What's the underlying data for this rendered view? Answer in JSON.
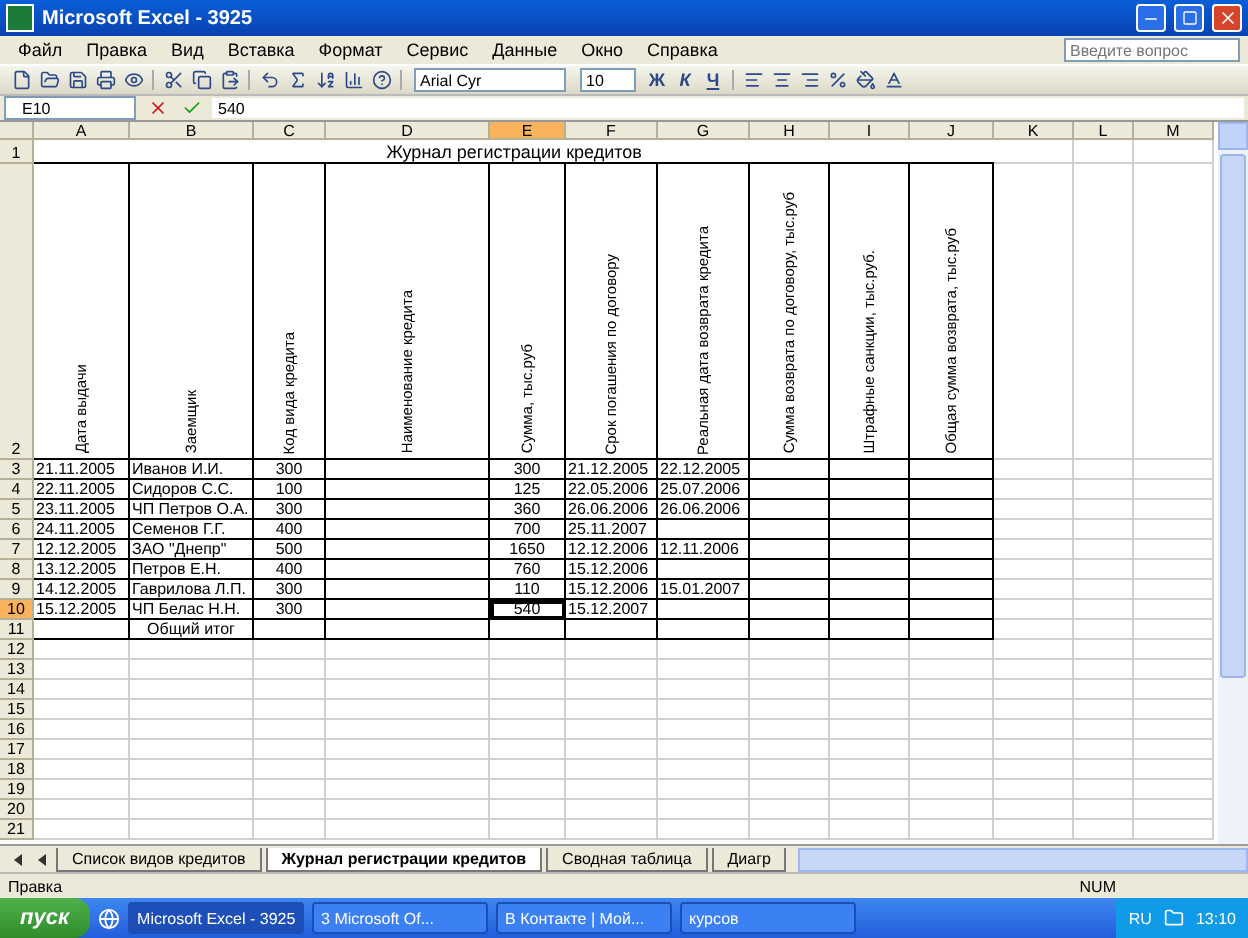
{
  "window": {
    "title": "Microsoft Excel - 3925"
  },
  "menu": [
    "Файл",
    "Правка",
    "Вид",
    "Вставка",
    "Формат",
    "Сервис",
    "Данные",
    "Окно",
    "Справка"
  ],
  "help_box": {
    "placeholder": "Введите вопрос"
  },
  "font": {
    "name": "Arial Cyr",
    "size": "10"
  },
  "format_buttons": [
    "Ж",
    "К",
    "Ч"
  ],
  "formula_bar": {
    "cell": "E10",
    "value": "540"
  },
  "columns": [
    {
      "label": "A",
      "selected": false
    },
    {
      "label": "B",
      "selected": false
    },
    {
      "label": "C",
      "selected": false
    },
    {
      "label": "D",
      "selected": false
    },
    {
      "label": "E",
      "selected": true
    },
    {
      "label": "F",
      "selected": false
    },
    {
      "label": "G",
      "selected": false
    },
    {
      "label": "H",
      "selected": false
    },
    {
      "label": "I",
      "selected": false
    },
    {
      "label": "J",
      "selected": false
    },
    {
      "label": "K",
      "selected": false
    },
    {
      "label": "L",
      "selected": false
    },
    {
      "label": "M",
      "selected": false
    }
  ],
  "row_headers": [
    {
      "label": "1",
      "selected": false
    },
    {
      "label": "2",
      "selected": false
    },
    {
      "label": "3",
      "selected": false
    },
    {
      "label": "4",
      "selected": false
    },
    {
      "label": "5",
      "selected": false
    },
    {
      "label": "6",
      "selected": false
    },
    {
      "label": "7",
      "selected": false
    },
    {
      "label": "8",
      "selected": false
    },
    {
      "label": "9",
      "selected": false
    },
    {
      "label": "10",
      "selected": true
    },
    {
      "label": "11",
      "selected": false
    },
    {
      "label": "12",
      "selected": false
    },
    {
      "label": "13",
      "selected": false
    },
    {
      "label": "14",
      "selected": false
    },
    {
      "label": "15",
      "selected": false
    },
    {
      "label": "16",
      "selected": false
    },
    {
      "label": "17",
      "selected": false
    },
    {
      "label": "18",
      "selected": false
    },
    {
      "label": "19",
      "selected": false
    },
    {
      "label": "20",
      "selected": false
    },
    {
      "label": "21",
      "selected": false
    }
  ],
  "title": "Журнал регистрации кредитов",
  "headers": [
    "Дата выдачи",
    "Заемщик",
    "Код вида кредита",
    "Наименование кредита",
    "Сумма, тыс.руб",
    "Срок погашения по договору",
    "Реальная дата возврата кредита",
    "Сумма возврата по договору, тыс.руб",
    "Штрафные санкции, тыс.руб.",
    "Общая сумма возврата, тыс.руб"
  ],
  "data_rows": [
    {
      "date": "21.11.2005",
      "borrower": "Иванов И.И.",
      "code": "300",
      "amount": "300",
      "due": "21.12.2005",
      "returned": "22.12.2005"
    },
    {
      "date": "22.11.2005",
      "borrower": "Сидоров С.С.",
      "code": "100",
      "amount": "125",
      "due": "22.05.2006",
      "returned": "25.07.2006"
    },
    {
      "date": "23.11.2005",
      "borrower": "ЧП Петров О.А.",
      "code": "300",
      "amount": "360",
      "due": "26.06.2006",
      "returned": "26.06.2006"
    },
    {
      "date": "24.11.2005",
      "borrower": "Семенов Г.Г.",
      "code": "400",
      "amount": "700",
      "due": "25.11.2007"
    },
    {
      "date": "12.12.2005",
      "borrower": "ЗАО \"Днепр\"",
      "code": "500",
      "amount": "1650",
      "due": "12.12.2006",
      "returned": "12.11.2006"
    },
    {
      "date": "13.12.2005",
      "borrower": "Петров Е.Н.",
      "code": "400",
      "amount": "760",
      "due": "15.12.2006"
    },
    {
      "date": "14.12.2005",
      "borrower": "Гаврилова Л.П.",
      "code": "300",
      "amount": "110",
      "due": "15.12.2006",
      "returned": "15.01.2007"
    },
    {
      "date": "15.12.2005",
      "borrower": "ЧП Белас Н.Н.",
      "code": "300",
      "amount": "540",
      "due": "15.12.2007"
    }
  ],
  "total_label": "Общий итог",
  "sheet_tabs": [
    {
      "label": "Список видов кредитов",
      "selected": false
    },
    {
      "label": "Журнал регистрации кредитов",
      "selected": true
    },
    {
      "label": "Сводная таблица",
      "selected": false
    },
    {
      "label": "Диагр",
      "selected": false
    }
  ],
  "status_bar": {
    "mode": "Правка",
    "indicator": "NUM"
  },
  "taskbar": {
    "start": "пуск",
    "tasks": [
      {
        "label": "Microsoft Excel - 3925",
        "selected": true
      },
      {
        "label": "3 Microsoft Of...",
        "selected": false
      },
      {
        "label": "В Контакте | Мой...",
        "selected": false
      },
      {
        "label": "курсов",
        "selected": false
      }
    ],
    "language": "RU",
    "clock": "13:10"
  }
}
